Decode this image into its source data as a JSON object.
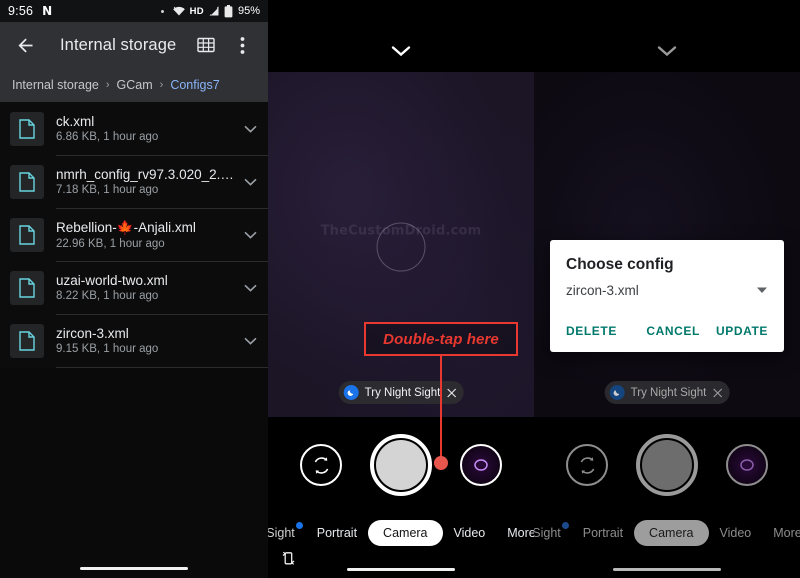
{
  "file_manager": {
    "status_bar": {
      "clock": "9:56",
      "carrier_icon": "nfc-icon",
      "carrier_letter": "N",
      "dot_icon": "dot-icon",
      "wifi_icon": "wifi-icon",
      "hd_label": "HD",
      "signal_icon": "signal-icon",
      "battery_icon": "battery-icon",
      "battery_label": "95%"
    },
    "toolbar": {
      "back_icon": "back-arrow-icon",
      "title": "Internal storage",
      "grid_icon": "grid-view-icon",
      "overflow_icon": "more-vert-icon"
    },
    "breadcrumb": {
      "items": [
        {
          "label": "Internal storage",
          "active": false
        },
        {
          "label": "GCam",
          "active": false
        },
        {
          "label": "Configs7",
          "active": true
        }
      ],
      "separator": "›"
    },
    "files": [
      {
        "name": "ck.xml",
        "meta": "6.86 KB, 1 hour ago",
        "icon": "file-xml-icon",
        "caret": "expand-more-icon"
      },
      {
        "name": "nmrh_config_rv97.3.020_2.0.x…",
        "meta": "7.18 KB, 1 hour ago",
        "icon": "file-xml-icon",
        "caret": "expand-more-icon"
      },
      {
        "name": "Rebellion-🍁-Anjali.xml",
        "meta": "22.96 KB, 1 hour ago",
        "icon": "file-xml-icon",
        "caret": "expand-more-icon"
      },
      {
        "name": "uzai-world-two.xml",
        "meta": "8.22 KB, 1 hour ago",
        "icon": "file-xml-icon",
        "caret": "expand-more-icon"
      },
      {
        "name": "zircon-3.xml",
        "meta": "9.15 KB, 1 hour ago",
        "icon": "file-xml-icon",
        "caret": "expand-more-icon"
      }
    ]
  },
  "camera_left": {
    "chevron_icon": "chevron-down-icon",
    "watermark": "TheCustomDroid.com",
    "focus_ring": "focus-ring-icon",
    "night_chip": {
      "badge_icon": "moon-icon",
      "label": "Try Night Sight",
      "close_icon": "close-icon"
    },
    "controls": {
      "flip_icon": "camera-flip-icon",
      "shutter_icon": "shutter-button",
      "lens_icon": "lens-preview-icon"
    },
    "modes": [
      {
        "label": "Sight",
        "selected": false,
        "dot": true
      },
      {
        "label": "Portrait",
        "selected": false,
        "dot": false
      },
      {
        "label": "Camera",
        "selected": true,
        "dot": false
      },
      {
        "label": "Video",
        "selected": false,
        "dot": false
      },
      {
        "label": "More",
        "selected": false,
        "dot": false
      }
    ],
    "rotate_icon": "rotate-screen-icon"
  },
  "camera_right": {
    "chevron_icon": "chevron-down-icon",
    "night_chip": {
      "badge_icon": "moon-icon",
      "label": "Try Night Sight",
      "close_icon": "close-icon"
    },
    "controls": {
      "flip_icon": "camera-flip-icon",
      "shutter_icon": "shutter-button",
      "lens_icon": "lens-preview-icon"
    },
    "modes": [
      {
        "label": "Sight",
        "selected": false,
        "dot": true
      },
      {
        "label": "Portrait",
        "selected": false,
        "dot": false
      },
      {
        "label": "Camera",
        "selected": true,
        "dot": false
      },
      {
        "label": "Video",
        "selected": false,
        "dot": false
      },
      {
        "label": "More",
        "selected": false,
        "dot": false
      }
    ]
  },
  "dialog": {
    "title": "Choose config",
    "selected_value": "zircon-3.xml",
    "dropdown_icon": "arrow-drop-down-icon",
    "delete_label": "DELETE",
    "cancel_label": "CANCEL",
    "update_label": "UPDATE",
    "action_color": "#00796b"
  },
  "annotation": {
    "label": "Double-tap here",
    "color": "#e8382f"
  }
}
